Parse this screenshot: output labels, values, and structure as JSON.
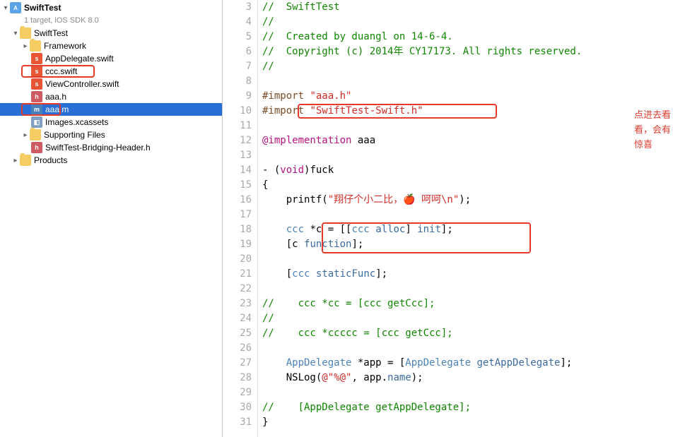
{
  "project": {
    "name": "SwiftTest",
    "subtitle": "1 target, iOS SDK 8.0"
  },
  "nav": {
    "folders": {
      "swiftTest": "SwiftTest",
      "framework": "Framework",
      "images": "Images.xcassets",
      "supporting": "Supporting Files",
      "products": "Products"
    },
    "files": {
      "appDelegate": "AppDelegate.swift",
      "ccc": "ccc.swift",
      "viewController": "ViewController.swift",
      "aaaH": "aaa.h",
      "aaaM": "aaa.m",
      "bridging": "SwiftTest-Bridging-Header.h"
    }
  },
  "gutterStart": 3,
  "gutterEnd": 31,
  "source": {
    "l3": "//  SwiftTest",
    "l4": "//",
    "l5": "//  Created by duangl on 14-6-4.",
    "l6": "//  Copyright (c) 2014年 CY17173. All rights reserved.",
    "l7": "//",
    "l8": "",
    "l9a": "#import ",
    "l9b": "\"aaa.h\"",
    "l10a": "#import ",
    "l10b": "\"SwiftTest-Swift.h\"",
    "l11": "",
    "l12a": "@implementation",
    "l12b": " aaa",
    "l13": "",
    "l14a": "- (",
    "l14b": "void",
    "l14c": ")fuck",
    "l15": "{",
    "l16a": "    printf(",
    "l16b": "\"翔仔个小二比，🍎 呵呵\\n\"",
    "l16c": ");",
    "l17": "",
    "l18a": "    ",
    "l18b": "ccc",
    "l18c": " *c = [[",
    "l18d": "ccc",
    "l18e": " ",
    "l18f": "alloc",
    "l18g": "] ",
    "l18h": "init",
    "l18i": "];",
    "l19a": "    [c ",
    "l19b": "function",
    "l19c": "];",
    "l20": "",
    "l21a": "    [",
    "l21b": "ccc",
    "l21c": " ",
    "l21d": "staticFunc",
    "l21e": "];",
    "l22": "",
    "l23": "//    ccc *cc = [ccc getCcc];",
    "l24": "//",
    "l25": "//    ccc *ccccc = [ccc getCcc];",
    "l26": "",
    "l27a": "    ",
    "l27b": "AppDelegate",
    "l27c": " *app = [",
    "l27d": "AppDelegate",
    "l27e": " ",
    "l27f": "getAppDelegate",
    "l27g": "];",
    "l28a": "    NSLog(",
    "l28b": "@\"%@\"",
    "l28c": ", app.",
    "l28d": "name",
    "l28e": ");",
    "l29": "",
    "l30": "//    [AppDelegate getAppDelegate];",
    "l31": "}"
  },
  "annotation": "点进去看看，会有惊喜"
}
